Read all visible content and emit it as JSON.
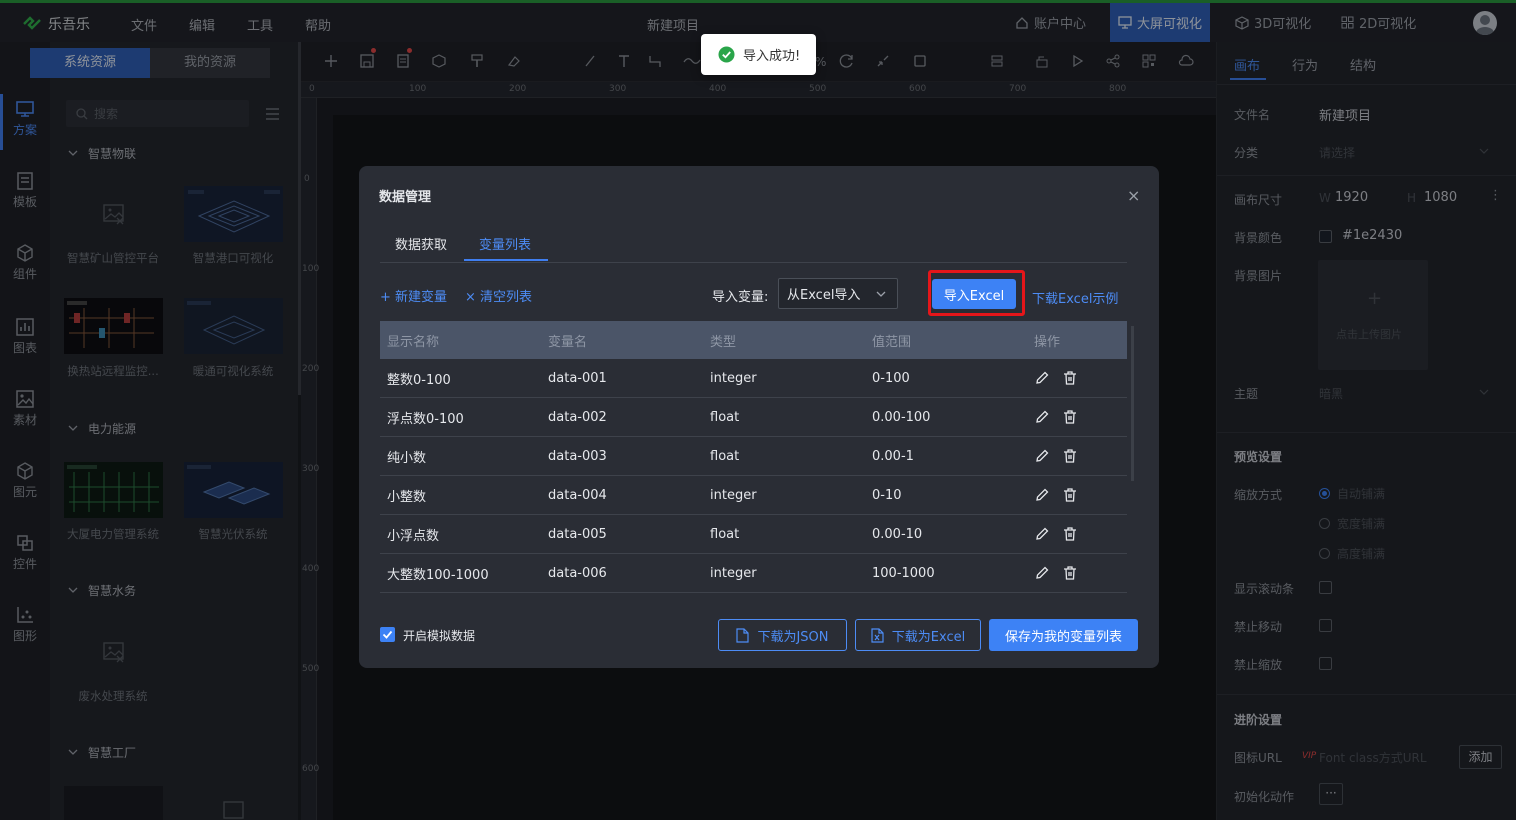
{
  "app": {
    "name": "乐吾乐",
    "menus": [
      "文件",
      "编辑",
      "工具",
      "帮助"
    ],
    "project_title": "新建项目"
  },
  "topnav": {
    "account": "账户中心",
    "bigscreen": "大屏可视化",
    "viz3d": "3D可视化",
    "viz2d": "2D可视化"
  },
  "rail": [
    "方案",
    "模板",
    "组件",
    "图表",
    "素材",
    "图元",
    "控件",
    "图形"
  ],
  "left_panel": {
    "tabs": [
      "系统资源",
      "我的资源"
    ],
    "search_placeholder": "搜索",
    "groups": [
      {
        "name": "智慧物联",
        "items": [
          "智慧矿山管控平台",
          "智慧港口可视化",
          "换热站远程监控...",
          "暖通可视化系统"
        ]
      },
      {
        "name": "电力能源",
        "items": [
          "大厦电力管理系统",
          "智慧光伏系统"
        ]
      },
      {
        "name": "智慧水务",
        "items": [
          "废水处理系统"
        ]
      },
      {
        "name": "智慧工厂",
        "items": []
      }
    ]
  },
  "ruler": {
    "h": [
      "0",
      "100",
      "200",
      "300",
      "400",
      "500",
      "600",
      "700",
      "800"
    ],
    "v": [
      "0",
      "100",
      "200",
      "300",
      "400",
      "500",
      "600"
    ]
  },
  "toolbar": {
    "zoom_suffix": "%"
  },
  "right_panel": {
    "tabs": [
      "画布",
      "行为",
      "结构"
    ],
    "file_label": "文件名",
    "file_value": "新建项目",
    "category_label": "分类",
    "category_placeholder": "请选择",
    "size_label": "画布尺寸",
    "w_label": "W",
    "w_value": "1920",
    "h_label": "H",
    "h_value": "1080",
    "bgcolor_label": "背景颜色",
    "bgcolor_value": "#1e2430",
    "bgimage_label": "背景图片",
    "bgimage_hint": "点击上传图片",
    "theme_label": "主题",
    "theme_value": "暗黑",
    "preview_title": "预览设置",
    "scale_label": "缩放方式",
    "scale_options": [
      "自动铺满",
      "宽度铺满",
      "高度铺满"
    ],
    "scroll_label": "显示滚动条",
    "nomove_label": "禁止移动",
    "nozoom_label": "禁止缩放",
    "advanced_title": "进阶设置",
    "iconurl_label": "图标URL",
    "vip": "VIP",
    "iconurl_placeholder": "Font class方式URL",
    "add_button": "添加",
    "init_label": "初始化动作",
    "init_button": "···"
  },
  "modal": {
    "title": "数据管理",
    "tabs": [
      "数据获取",
      "变量列表"
    ],
    "new_var": "+ 新建变量",
    "clear_list": "× 清空列表",
    "import_label": "导入变量:",
    "import_select": "从Excel导入",
    "import_button": "导入Excel",
    "download_sample": "下载Excel示例",
    "columns": [
      "显示名称",
      "变量名",
      "类型",
      "值范围",
      "操作"
    ],
    "rows": [
      {
        "name": "整数0-100",
        "var": "data-001",
        "type": "integer",
        "range": "0-100"
      },
      {
        "name": "浮点数0-100",
        "var": "data-002",
        "type": "float",
        "range": "0.00-100"
      },
      {
        "name": "纯小数",
        "var": "data-003",
        "type": "float",
        "range": "0.00-1"
      },
      {
        "name": "小整数",
        "var": "data-004",
        "type": "integer",
        "range": "0-10"
      },
      {
        "name": "小浮点数",
        "var": "data-005",
        "type": "float",
        "range": "0.00-10"
      },
      {
        "name": "大整数100-1000",
        "var": "data-006",
        "type": "integer",
        "range": "100-1000"
      }
    ],
    "mock_label": "开启模拟数据",
    "download_json": "下载为JSON",
    "download_excel": "下载为Excel",
    "save_button": "保存为我的变量列表"
  },
  "toast": {
    "message": "导入成功!"
  },
  "colors": {
    "accent": "#3d82f5",
    "highlight": "#e5161a",
    "success": "#2aa54a",
    "brand": "#2a9a3f"
  }
}
